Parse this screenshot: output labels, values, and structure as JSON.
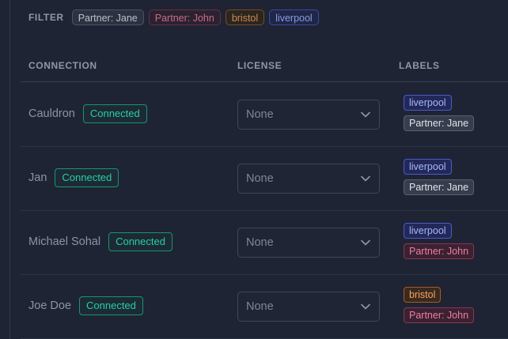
{
  "filter": {
    "label": "FILTER",
    "chips": [
      {
        "label": "Partner: Jane",
        "color": "jane"
      },
      {
        "label": "Partner: John",
        "color": "john"
      },
      {
        "label": "bristol",
        "color": "bristol"
      },
      {
        "label": "liverpool",
        "color": "liverpool"
      }
    ]
  },
  "columns": {
    "connection": "CONNECTION",
    "license": "LICENSE",
    "labels": "LABELS"
  },
  "rows": [
    {
      "name": "Cauldron",
      "status": "Connected",
      "license": "None",
      "labels": [
        {
          "text": "liverpool",
          "color": "liverpool"
        },
        {
          "text": "Partner: Jane",
          "color": "jane"
        }
      ]
    },
    {
      "name": "Jan",
      "status": "Connected",
      "license": "None",
      "labels": [
        {
          "text": "liverpool",
          "color": "liverpool"
        },
        {
          "text": "Partner: Jane",
          "color": "jane"
        }
      ]
    },
    {
      "name": "Michael Sohal",
      "status": "Connected",
      "license": "None",
      "labels": [
        {
          "text": "liverpool",
          "color": "liverpool"
        },
        {
          "text": "Partner: John",
          "color": "john"
        }
      ]
    },
    {
      "name": "Joe Doe",
      "status": "Connected",
      "license": "None",
      "labels": [
        {
          "text": "bristol",
          "color": "bristol"
        },
        {
          "text": "Partner: John",
          "color": "john"
        }
      ]
    }
  ],
  "icons": {
    "dropdown": "chevron-down-icon"
  },
  "colors": {
    "background": "#1e2433",
    "connected": "#25d0a0",
    "liverpool": "#a7b7f5",
    "jane": "#dfe3ea",
    "john": "#f07ba8",
    "bristol": "#f6a35f"
  }
}
